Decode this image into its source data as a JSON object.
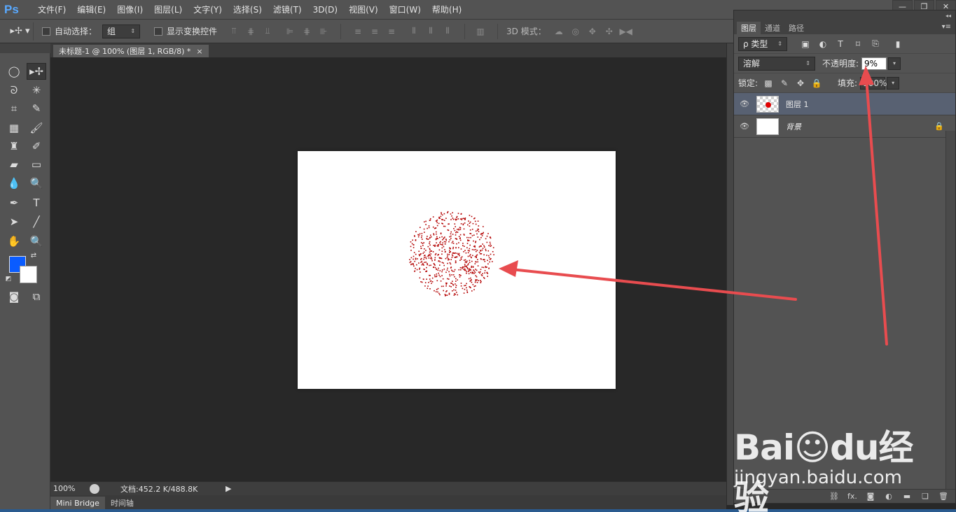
{
  "app": {
    "logo": "Ps",
    "menu": [
      "文件(F)",
      "编辑(E)",
      "图像(I)",
      "图层(L)",
      "文字(Y)",
      "选择(S)",
      "滤镜(T)",
      "3D(D)",
      "视图(V)",
      "窗口(W)",
      "帮助(H)"
    ],
    "window_controls": {
      "minimize": "—",
      "restore": "❐",
      "close": "✕"
    }
  },
  "options": {
    "auto_select_label": "自动选择：",
    "auto_select_value": "组",
    "show_transform_label": "显示变换控件",
    "mode3d_label": "3D 模式："
  },
  "document": {
    "tab_title": "未标题-1 @ 100% (图层 1, RGB/8) *",
    "close": "×",
    "dot_color": "#b30000"
  },
  "status": {
    "zoom": "100%",
    "doc_info": "文档:452.2 K/488.8K",
    "arrow": "▶"
  },
  "bottom_tabs": [
    "Mini Bridge",
    "时间轴"
  ],
  "colors": {
    "foreground": "#0a5cff",
    "background": "#ffffff",
    "arrow": "#e84c4f"
  },
  "layers_panel": {
    "collapse": "◂◂",
    "tabs": [
      "图层",
      "通道",
      "路径"
    ],
    "menu": "▾≡",
    "filter_kind": "ρ 类型",
    "blend_mode": "溶解",
    "opacity_label": "不透明度:",
    "opacity_value": "9%",
    "lock_label": "锁定:",
    "fill_label": "填充:",
    "fill_value": "100%",
    "layers": [
      {
        "name": "图层 1",
        "selected": true,
        "eye": "👁"
      },
      {
        "name": "背景",
        "selected": false,
        "locked": true,
        "eye": "👁"
      }
    ],
    "footer": [
      "⛓",
      "fx.",
      "◙",
      "◐",
      "▬",
      "❏",
      "🗑"
    ]
  },
  "watermark": {
    "brand": "Bai☺du经验",
    "url": "jingyan.baidu.com"
  }
}
